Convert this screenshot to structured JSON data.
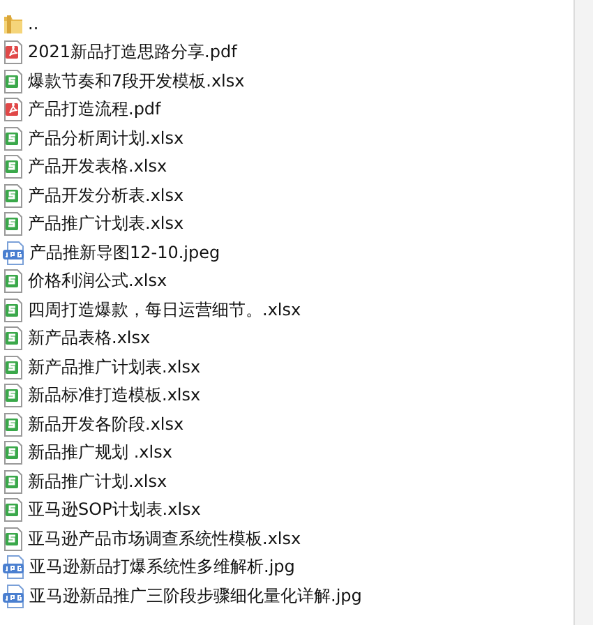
{
  "files": [
    {
      "name": "..",
      "kind": "folder"
    },
    {
      "name": "2021新品打造思路分享.pdf",
      "kind": "pdf"
    },
    {
      "name": "爆款节奏和7段开发模板.xlsx",
      "kind": "xlsx"
    },
    {
      "name": "产品打造流程.pdf",
      "kind": "pdf"
    },
    {
      "name": "产品分析周计划.xlsx",
      "kind": "xlsx"
    },
    {
      "name": "产品开发表格.xlsx",
      "kind": "xlsx"
    },
    {
      "name": "产品开发分析表.xlsx",
      "kind": "xlsx"
    },
    {
      "name": "产品推广计划表.xlsx",
      "kind": "xlsx"
    },
    {
      "name": "产品推新导图12-10.jpeg",
      "kind": "jpg"
    },
    {
      "name": "价格利润公式.xlsx",
      "kind": "xlsx"
    },
    {
      "name": "四周打造爆款，每日运营细节。.xlsx",
      "kind": "xlsx"
    },
    {
      "name": "新产品表格.xlsx",
      "kind": "xlsx"
    },
    {
      "name": "新产品推广计划表.xlsx",
      "kind": "xlsx"
    },
    {
      "name": "新品标准打造模板.xlsx",
      "kind": "xlsx"
    },
    {
      "name": "新品开发各阶段.xlsx",
      "kind": "xlsx"
    },
    {
      "name": "新品推广规划 .xlsx",
      "kind": "xlsx"
    },
    {
      "name": "新品推广计划.xlsx",
      "kind": "xlsx"
    },
    {
      "name": "亚马逊SOP计划表.xlsx",
      "kind": "xlsx"
    },
    {
      "name": "亚马逊产品市场调查系统性模板.xlsx",
      "kind": "xlsx"
    },
    {
      "name": "亚马逊新品打爆系统性多维解析.jpg",
      "kind": "jpg"
    },
    {
      "name": "亚马逊新品推广三阶段步骤细化量化详解.jpg",
      "kind": "jpg"
    }
  ]
}
